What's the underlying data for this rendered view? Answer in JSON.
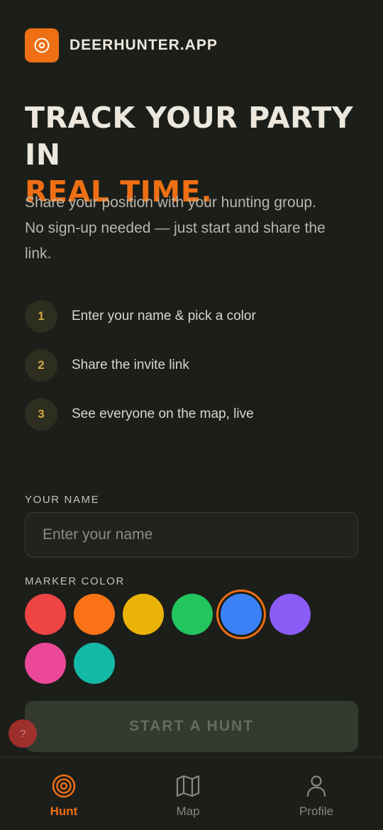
{
  "brand": {
    "name": "DEERHUNTER.APP",
    "accent": "#ee6f14"
  },
  "hero": {
    "line1": "TRACK YOUR PARTY IN",
    "line2": "REAL TIME."
  },
  "intro": "Share your position with your hunting group. No sign-up needed — just start and share the link.",
  "steps": [
    {
      "num": "1",
      "text": "Enter your name & pick a color"
    },
    {
      "num": "2",
      "text": "Share the invite link"
    },
    {
      "num": "3",
      "text": "See everyone on the map, live"
    }
  ],
  "form": {
    "name_label": "YOUR NAME",
    "name_placeholder": "Enter your name",
    "name_value": "",
    "color_label": "MARKER COLOR",
    "colors": [
      "#ef4444",
      "#f97316",
      "#eab308",
      "#22c55e",
      "#3b82f6",
      "#8b5cf6",
      "#ec4899",
      "#14b8a6"
    ],
    "selected_color": "#3b82f6",
    "start_label": "START A HUNT"
  },
  "help": {
    "label": "?"
  },
  "nav": {
    "items": [
      {
        "label": "Hunt",
        "icon": "target-icon",
        "active": true
      },
      {
        "label": "Map",
        "icon": "map-icon",
        "active": false
      },
      {
        "label": "Profile",
        "icon": "user-icon",
        "active": false
      }
    ]
  }
}
